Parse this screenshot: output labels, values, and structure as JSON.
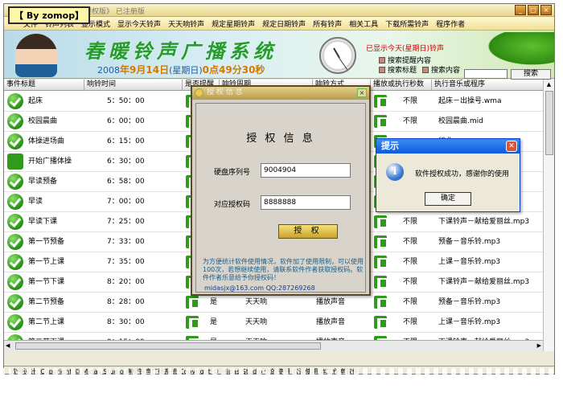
{
  "app": {
    "title_faded": "测音铃声 6.0  《读授权版》  已注册版",
    "badge": "【 By zomop】"
  },
  "menu": [
    "文件",
    "铃声列表",
    "显示模式",
    "显示今天铃声",
    "天天响铃声",
    "规定星期铃声",
    "规定日期铃声",
    "所有铃声",
    "相关工具",
    "下载所需铃声",
    "程序作者"
  ],
  "window_buttons": [
    "_",
    "□",
    "×"
  ],
  "banner": {
    "logo": "春暖铃声广播系统",
    "date_prefix": "2008",
    "year_suffix": "年",
    "date_mid": "9月14日",
    "weekday": "(星期日)",
    "time": "0点49分30秒",
    "show_today": "已显示今天(星期日)铃声",
    "cb1": "搜索提醒内容",
    "cb2": "搜索标题",
    "cb3": "搜索内容",
    "search_button": "搜索"
  },
  "table": {
    "headers": [
      "事件标题",
      "响铃时间",
      "是否提醒",
      "响铃周期",
      "响铃方式",
      "播放或执行秒数",
      "执行音乐或程序"
    ],
    "rows": [
      {
        "title": "起床",
        "time": "5：50：00",
        "remind": "",
        "cycle": "",
        "mode": "",
        "secs": "不限",
        "prog": "起床－出操号.wma"
      },
      {
        "title": "校园晨曲",
        "time": "6：00：00",
        "remind": "",
        "cycle": "",
        "mode": "",
        "secs": "不限",
        "prog": "校园晨曲.mid"
      },
      {
        "title": "体操进场曲",
        "time": "6：15：00",
        "remind": "",
        "cycle": "",
        "mode": "",
        "secs": "",
        "prog": "行曲."
      },
      {
        "title": "开始广播体操",
        "time": "6：30：00",
        "remind": "",
        "cycle": "",
        "mode": "",
        "secs": "",
        "prog": "播体"
      },
      {
        "title": "早读预备",
        "time": "6：58：00",
        "remind": "",
        "cycle": "",
        "mode": "",
        "secs": "",
        "prog": ""
      },
      {
        "title": "早读",
        "time": "7：00：00",
        "remind": "",
        "cycle": "",
        "mode": "",
        "secs": "",
        "prog": ""
      },
      {
        "title": "早读下课",
        "time": "7：25：00",
        "remind": "",
        "cycle": "",
        "mode": "",
        "secs": "不限",
        "prog": "下课铃声－献给爱丽丝.mp3"
      },
      {
        "title": "第一节预备",
        "time": "7：33：00",
        "remind": "",
        "cycle": "",
        "mode": "",
        "secs": "不限",
        "prog": "预备－音乐铃.mp3"
      },
      {
        "title": "第一节上课",
        "time": "7：35：00",
        "remind": "",
        "cycle": "",
        "mode": "",
        "secs": "不限",
        "prog": "上课－音乐铃.mp3"
      },
      {
        "title": "第一节下课",
        "time": "8：20：00",
        "remind": "",
        "cycle": "",
        "mode": "",
        "secs": "不限",
        "prog": "下课铃声－献给爱丽丝.mp3"
      },
      {
        "title": "第二节预备",
        "time": "8：28：00",
        "remind": "是",
        "cycle": "天天响",
        "mode": "播放声音",
        "secs": "不限",
        "prog": "预备－音乐铃.mp3"
      },
      {
        "title": "第二节上课",
        "time": "8：30：00",
        "remind": "是",
        "cycle": "天天响",
        "mode": "播放声音",
        "secs": "不限",
        "prog": "上课－音乐铃.mp3"
      },
      {
        "title": "第二节下课",
        "time": "9：15：00",
        "remind": "是",
        "cycle": "天天响",
        "mode": "播放声音",
        "secs": "不限",
        "prog": "下课铃声－献给爱丽丝.mp3"
      }
    ]
  },
  "auth_dialog": {
    "title": "授 权 信 息",
    "heading": "授 权 信 息",
    "hdd_label": "硬盘序列号",
    "hdd_value": "9004904",
    "code_label": "对应授权码",
    "code_value": "8888888",
    "button": "授 权",
    "note": "为方便统计软件使用情况，软件加了使用限制，可以使用100次，若想继续使用，请联系软件作者获取授权码。软件作者乐意给予你授权码！",
    "contact": "midasjx@163.com QQ:287269268"
  },
  "tip_dialog": {
    "title": "提示",
    "message": "软件授权成功，感谢你的使用",
    "ok": "确定"
  },
  "status_bar": "软件设计: Copyright © Midas Studio        春暖铃声广播系统 Copyright © Midas Studio    你的使用    欢迎使用 本工作室软件",
  "colors": {
    "accent_green": "#2f9a1c",
    "title_blue": "#0a5adc"
  }
}
